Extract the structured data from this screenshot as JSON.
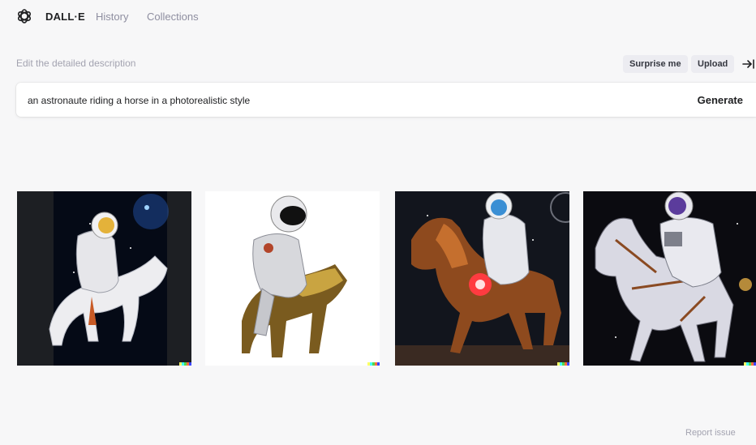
{
  "nav": {
    "logo_icon": "openai-logo-icon",
    "brand": "DALL·E",
    "links": [
      "History",
      "Collections"
    ]
  },
  "editor": {
    "label": "Edit the detailed description",
    "surprise_label": "Surprise me",
    "upload_label": "Upload",
    "collapse_icon": "collapse-right-icon",
    "prompt_value": "an astronaute riding a horse in a photorealistic style",
    "generate_label": "Generate"
  },
  "results": {
    "images": [
      {
        "subject": "astronaut on white horse in space"
      },
      {
        "subject": "astronaut riding golden horse"
      },
      {
        "subject": "astronaut on brown horse with glowing core"
      },
      {
        "subject": "astronaut on armored white horse"
      }
    ],
    "signature_colors": [
      "#ffff66",
      "#42ffff",
      "#51da4c",
      "#ff6e3c",
      "#3c46ff"
    ]
  },
  "footer": {
    "report_label": "Report issue"
  },
  "colors": {
    "background": "#f7f7f8",
    "chip_bg": "#ececf1",
    "muted_text": "#a3a3b0",
    "nav_muted": "#8e8ea0"
  }
}
